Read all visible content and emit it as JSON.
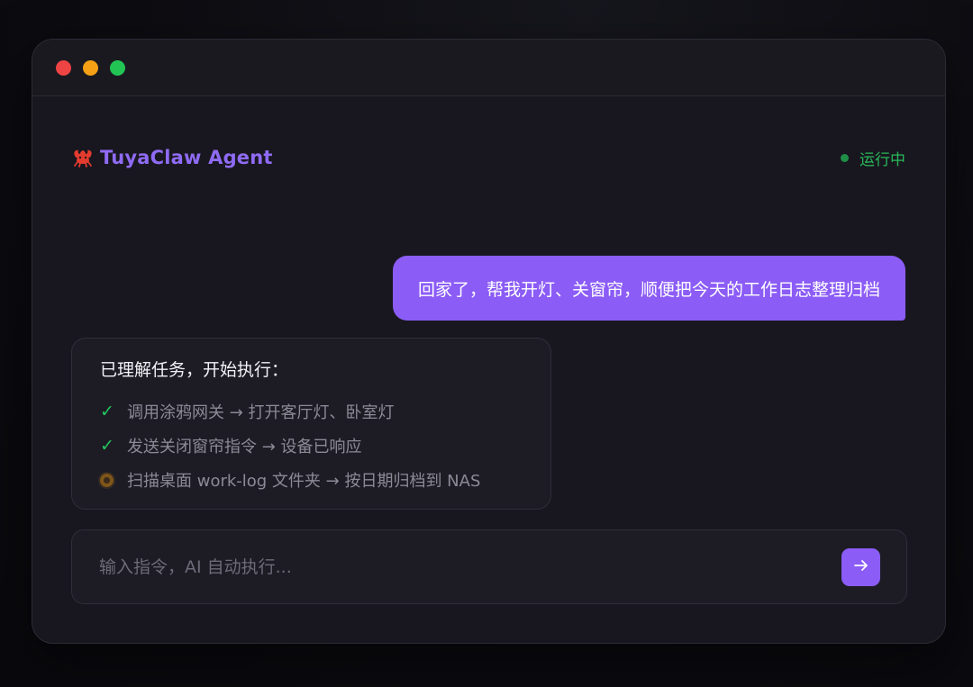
{
  "app": {
    "name": "TuyaClaw Agent",
    "brand_color": "#8f6bf4",
    "brand_icon": "crab-claw-icon"
  },
  "status": {
    "label": "运行中",
    "color": "#29b859"
  },
  "chat": {
    "user_message": "回家了，帮我开灯、关窗帘，顺便把今天的工作日志整理归档",
    "agent": {
      "title": "已理解任务，开始执行：",
      "steps": [
        {
          "state": "done",
          "icon": "check-icon",
          "text": "调用涂鸦网关 → 打开客厅灯、卧室灯"
        },
        {
          "state": "done",
          "icon": "check-icon",
          "text": "发送关闭窗帘指令 → 设备已响应"
        },
        {
          "state": "in-progress",
          "icon": "pending-dot-icon",
          "text": "扫描桌面 work-log 文件夹 → 按日期归档到 NAS"
        }
      ]
    }
  },
  "input": {
    "placeholder": "输入指令，AI 自动执行...",
    "value": "",
    "send_icon": "arrow-right-icon"
  },
  "colors": {
    "accent": "#8b5cf6",
    "success": "#22c55e",
    "pending": "#f59e0b"
  }
}
